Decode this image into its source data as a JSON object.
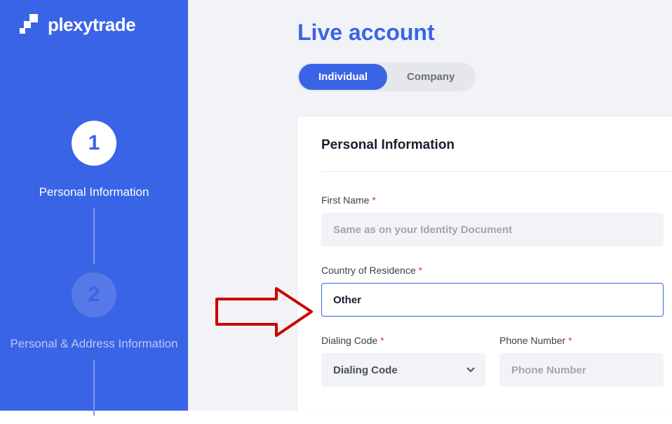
{
  "brand": {
    "name": "plexytrade"
  },
  "sidebar": {
    "steps": [
      {
        "num": "1",
        "label": "Personal Information"
      },
      {
        "num": "2",
        "label": "Personal & Address Information"
      }
    ]
  },
  "page": {
    "title": "Live account"
  },
  "toggle": {
    "individual": "Individual",
    "company": "Company"
  },
  "form": {
    "section_title": "Personal Information",
    "first_name": {
      "label": "First Name",
      "placeholder": "Same as on your Identity Document"
    },
    "country": {
      "label": "Country of Residence",
      "value": "Other"
    },
    "dialing": {
      "label": "Dialing Code",
      "placeholder": "Dialing Code"
    },
    "phone": {
      "label": "Phone Number",
      "placeholder": "Phone Number"
    }
  }
}
